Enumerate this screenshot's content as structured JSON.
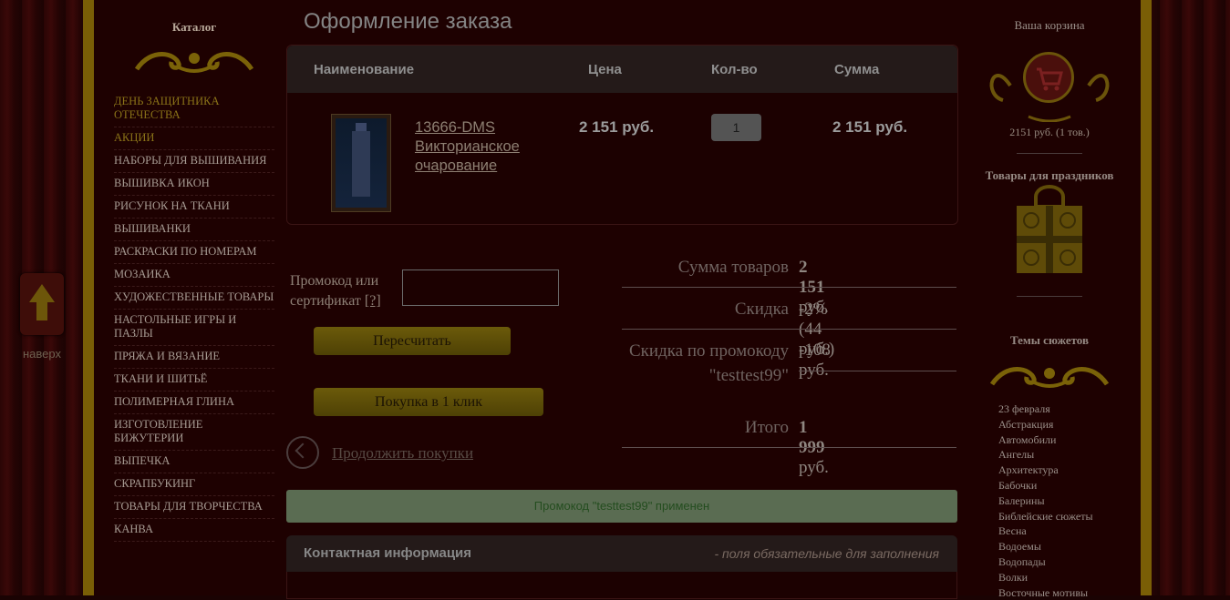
{
  "catalog": {
    "title": "Каталог",
    "items": [
      {
        "label": "ДЕНЬ ЗАЩИТНИКА ОТЕЧЕСТВА",
        "highlighted": true
      },
      {
        "label": "АКЦИИ",
        "highlighted": true
      },
      {
        "label": "НАБОРЫ ДЛЯ ВЫШИВАНИЯ"
      },
      {
        "label": "ВЫШИВКА ИКОН"
      },
      {
        "label": "РИСУНОК НА ТКАНИ"
      },
      {
        "label": "ВЫШИВАНКИ"
      },
      {
        "label": "РАСКРАСКИ ПО НОМЕРАМ"
      },
      {
        "label": "МОЗАИКА"
      },
      {
        "label": "ХУДОЖЕСТВЕННЫЕ ТОВАРЫ"
      },
      {
        "label": "НАСТОЛЬНЫЕ ИГРЫ И ПАЗЛЫ"
      },
      {
        "label": "ПРЯЖА И ВЯЗАНИЕ"
      },
      {
        "label": "ТКАНИ И ШИТЬЁ"
      },
      {
        "label": "ПОЛИМЕРНАЯ ГЛИНА"
      },
      {
        "label": "ИЗГОТОВЛЕНИЕ БИЖУТЕРИИ"
      },
      {
        "label": "ВЫПЕЧКА"
      },
      {
        "label": "СКРАПБУКИНГ"
      },
      {
        "label": "ТОВАРЫ ДЛЯ ТВОРЧЕСТВА"
      },
      {
        "label": "КАНВА"
      }
    ]
  },
  "scroll_top": {
    "label": "наверх",
    "icon": "arrow-up-icon"
  },
  "page_title": "Оформление заказа",
  "order_table": {
    "headers": {
      "name": "Наименование",
      "price": "Цена",
      "qty": "Кол-во",
      "sum": "Сумма"
    },
    "rows": [
      {
        "name": "13666-DMS Викторианское очарование",
        "price": "2 151 руб.",
        "qty": "1",
        "sum": "2 151 руб."
      }
    ]
  },
  "promo": {
    "label": "Промокод или сертификат",
    "help": "[?]",
    "value": "",
    "recalc_button": "Пересчитать",
    "one_click_button": "Покупка в 1 клик"
  },
  "continue_link": "Продолжить покупки",
  "totals": {
    "goods_label": "Сумма товаров",
    "goods_amount": "2 151",
    "currency": "руб.",
    "discount_label": "Скидка",
    "discount_value": "-2% (44 руб.)",
    "promo_discount_label": "Скидка по промокоду \"testtest99\"",
    "promo_discount_value": "-108 руб.",
    "total_label": "Итого",
    "total_amount": "1 999"
  },
  "success_message": "Промокод \"testtest99\" применен",
  "contact": {
    "title": "Контактная информация",
    "note": "- поля обязательные для заполнения"
  },
  "cart": {
    "title": "Ваша корзина",
    "info": "2151 руб.   (1 тов.)",
    "icon": "cart-icon"
  },
  "holidays": {
    "title": "Товары для праздников",
    "icon": "gift-icon"
  },
  "themes": {
    "title": "Темы сюжетов",
    "items": [
      "23 февраля",
      "Абстракция",
      "Автомобили",
      "Ангелы",
      "Архитектура",
      "Бабочки",
      "Балерины",
      "Библейские сюжеты",
      "Весна",
      "Водоемы",
      "Водопады",
      "Волки",
      "Восточные мотивы"
    ]
  },
  "colors": {
    "accent": "#7a5e06",
    "background": "#1e0101",
    "success_bg": "#5a6c52"
  }
}
